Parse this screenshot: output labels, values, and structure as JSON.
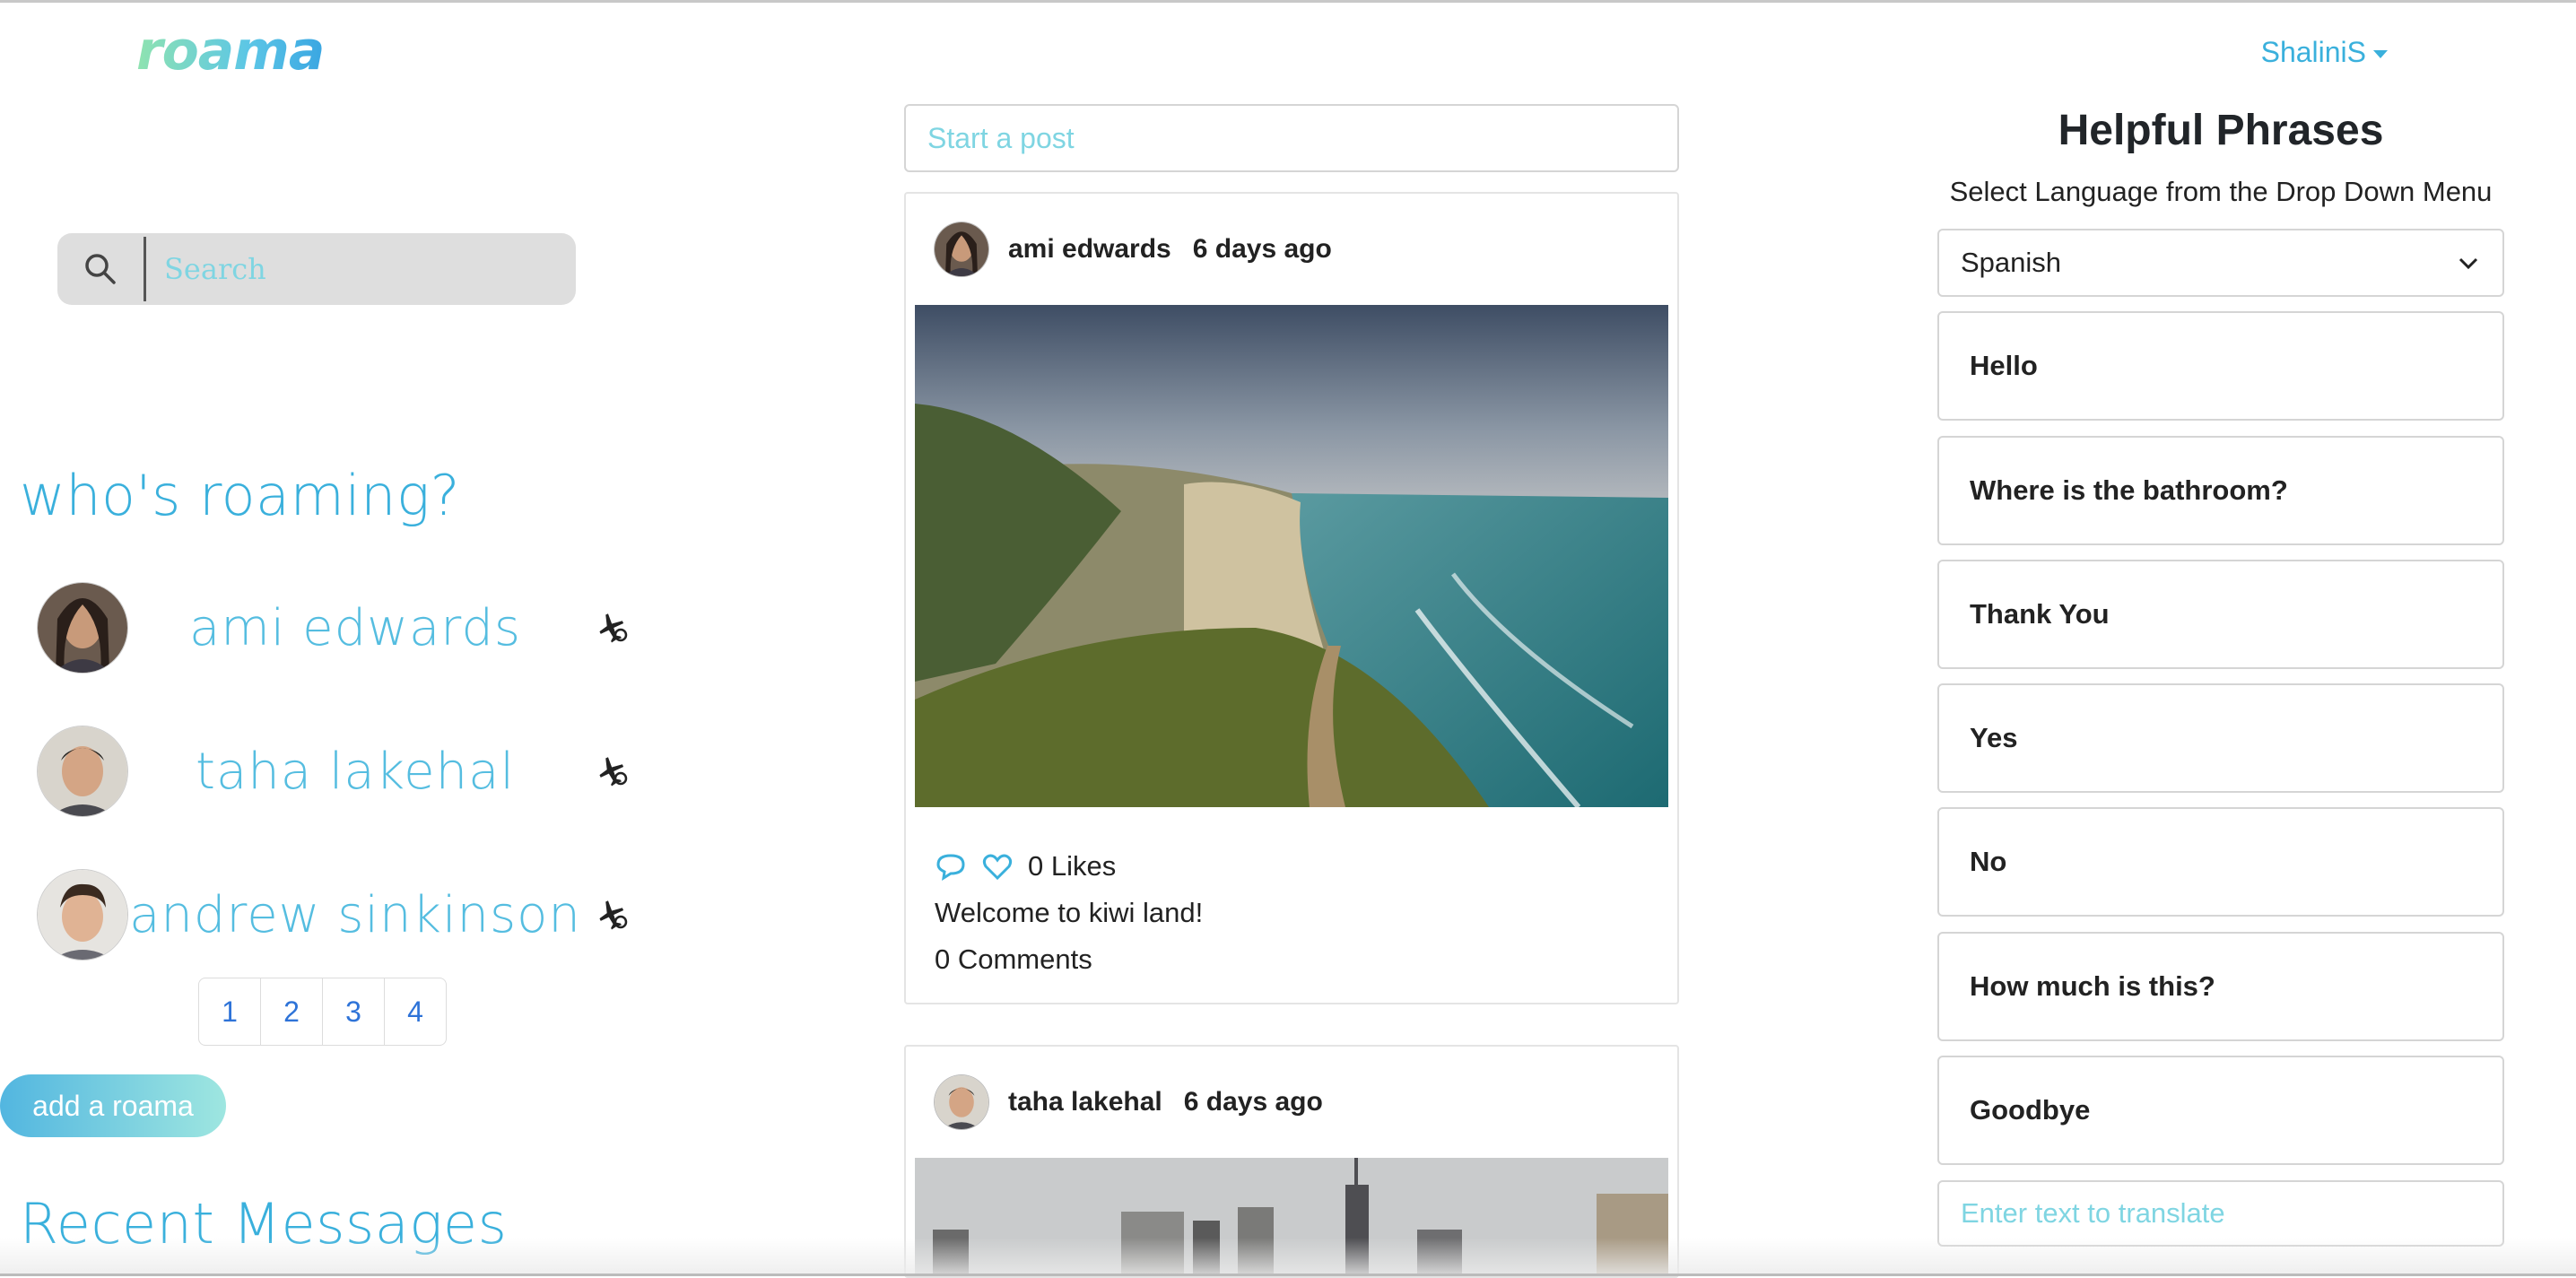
{
  "app": {
    "logo": "roama"
  },
  "header": {
    "user_menu": "ShaliniS"
  },
  "search": {
    "placeholder": "Search"
  },
  "sidebar": {
    "roaming_title": "who's roaming?",
    "roamers": [
      {
        "name": "ami edwards"
      },
      {
        "name": "taha lakehal"
      },
      {
        "name": "andrew sinkinson"
      }
    ],
    "pages": [
      "1",
      "2",
      "3",
      "4"
    ],
    "add_button": "add a roama",
    "messages_title": "Recent Messages"
  },
  "feed": {
    "post_placeholder": "Start a post",
    "posts": [
      {
        "author": "ami edwards",
        "time": "6 days ago",
        "likes": "0 Likes",
        "caption": "Welcome to kiwi land!",
        "comments": "0 Comments"
      },
      {
        "author": "taha lakehal",
        "time": "6 days ago"
      }
    ]
  },
  "phrases": {
    "title": "Helpful Phrases",
    "subtitle": "Select Language from the Drop Down Menu",
    "selected_language": "Spanish",
    "items": [
      "Hello",
      "Where is the bathroom?",
      "Thank You",
      "Yes",
      "No",
      "How much is this?",
      "Goodbye"
    ],
    "translate_placeholder": "Enter text to translate"
  },
  "colors": {
    "accent": "#3ab0dc",
    "link": "#2e73d8",
    "placeholder": "#7fd5e2"
  }
}
